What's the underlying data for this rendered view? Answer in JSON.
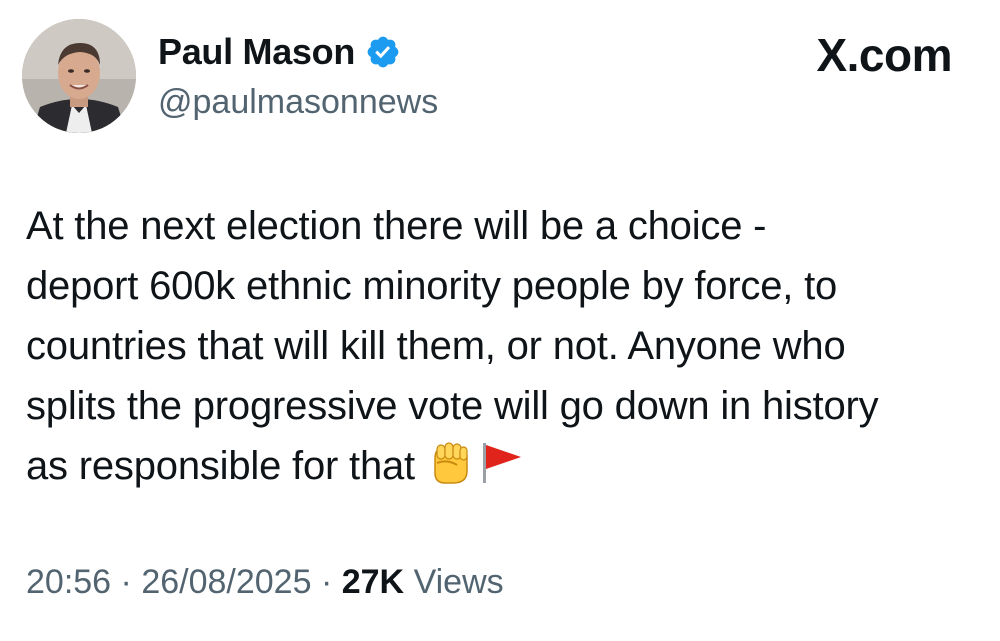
{
  "author": {
    "display_name": "Paul Mason",
    "handle": "@paulmasonnews",
    "verified": true,
    "verified_color": "#1d9bf0"
  },
  "brand": {
    "label": "X.com"
  },
  "tweet": {
    "line1": "At the next election there will be a choice -",
    "line2": "deport 600k ethnic minority people by force, to",
    "line3": "countries that will kill them, or not. Anyone who",
    "line4": "splits the progressive vote will go down in history",
    "line5": "as responsible for that",
    "emojis": [
      "raised-fist-icon",
      "red-flag-icon"
    ]
  },
  "meta": {
    "time": "20:56",
    "separator": "·",
    "date": "26/08/2025",
    "views_count": "27K",
    "views_label": "Views"
  },
  "colors": {
    "text_primary": "#0f1419",
    "text_secondary": "#536471"
  }
}
